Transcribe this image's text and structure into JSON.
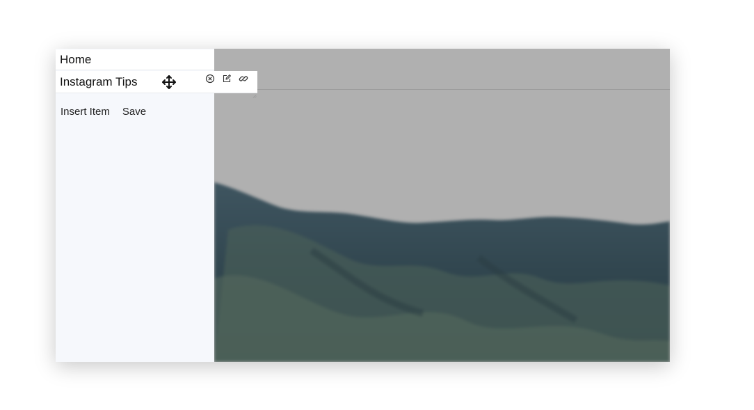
{
  "nav": {
    "home": "Home",
    "current_item": "Instagram Tips"
  },
  "item_actions": [
    "close-circle-icon",
    "edit-icon",
    "link-icon"
  ],
  "toolbar": {
    "insert_item": "Insert Item",
    "save": "Save"
  },
  "colors": {
    "sidebar_bg": "#f6f8fc",
    "sky": "#b0b0b0",
    "mountain_dark": "#2f4450",
    "mountain_mid": "#4e6258"
  }
}
